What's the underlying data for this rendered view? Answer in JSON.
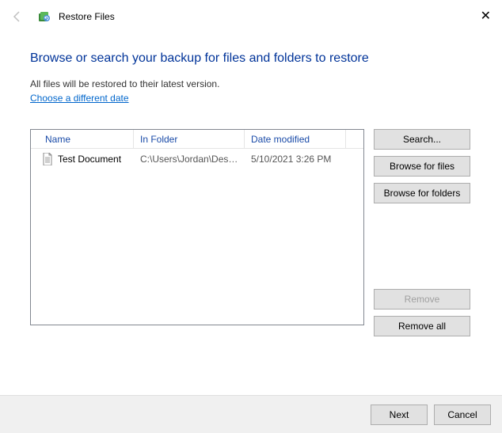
{
  "window": {
    "title": "Restore Files"
  },
  "heading": "Browse or search your backup for files and folders to restore",
  "subtext": "All files will be restored to their latest version.",
  "link": "Choose a different date",
  "columns": {
    "name": "Name",
    "folder": "In Folder",
    "date": "Date modified"
  },
  "rows": [
    {
      "name": "Test Document",
      "folder": "C:\\Users\\Jordan\\Deskt...",
      "date": "5/10/2021 3:26 PM"
    }
  ],
  "buttons": {
    "search": "Search...",
    "browse_files": "Browse for files",
    "browse_folders": "Browse for folders",
    "remove": "Remove",
    "remove_all": "Remove all",
    "next": "Next",
    "cancel": "Cancel"
  }
}
